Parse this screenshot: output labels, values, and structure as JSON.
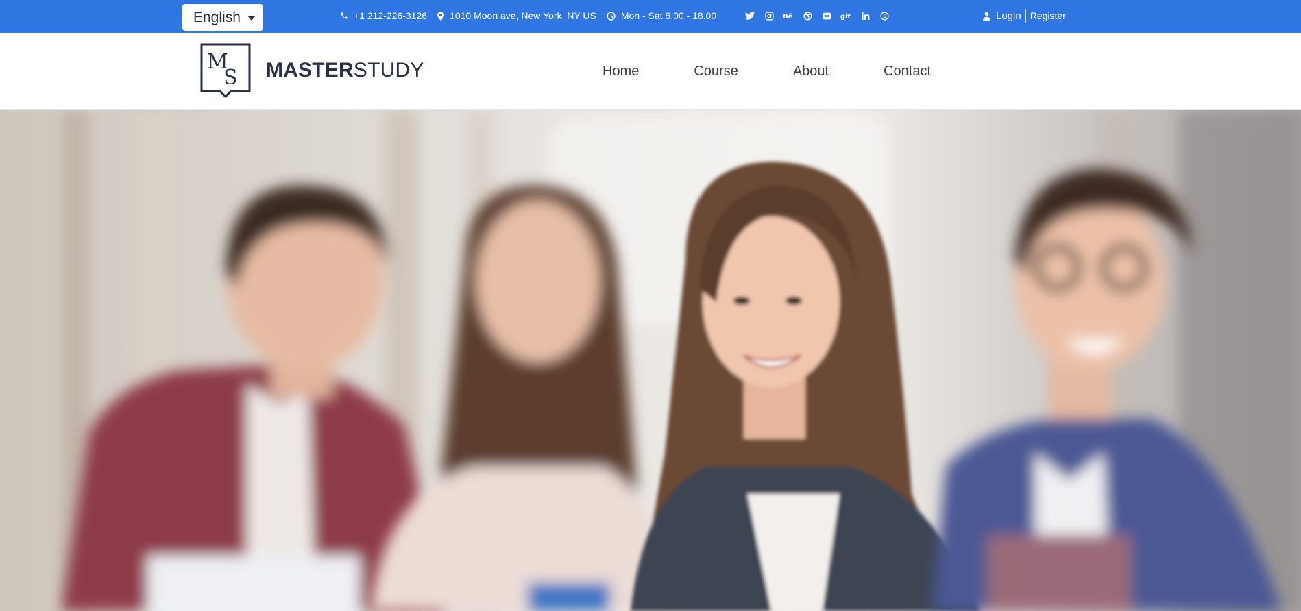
{
  "topbar": {
    "language": "English",
    "phone": "+1 212-226-3126",
    "address": "1010 Moon ave, New York, NY US",
    "hours": "Mon - Sat 8.00 - 18.00",
    "socials": [
      "twitter-icon",
      "instagram-icon",
      "behance-icon",
      "dribbble-icon",
      "flickr-icon",
      "git-icon",
      "linkedin-icon",
      "pinterest-icon"
    ],
    "login": "Login",
    "register": "Register",
    "background_color": "#2f76e2"
  },
  "header": {
    "logo_monogram_m": "M",
    "logo_monogram_s": "S",
    "brand_bold": "MASTER",
    "brand_light": "STUDY",
    "nav": [
      "Home",
      "Course",
      "About",
      "Contact"
    ],
    "brand_color": "#273044"
  },
  "hero": {
    "image_description": "blurred group of four smiling students holding books"
  }
}
